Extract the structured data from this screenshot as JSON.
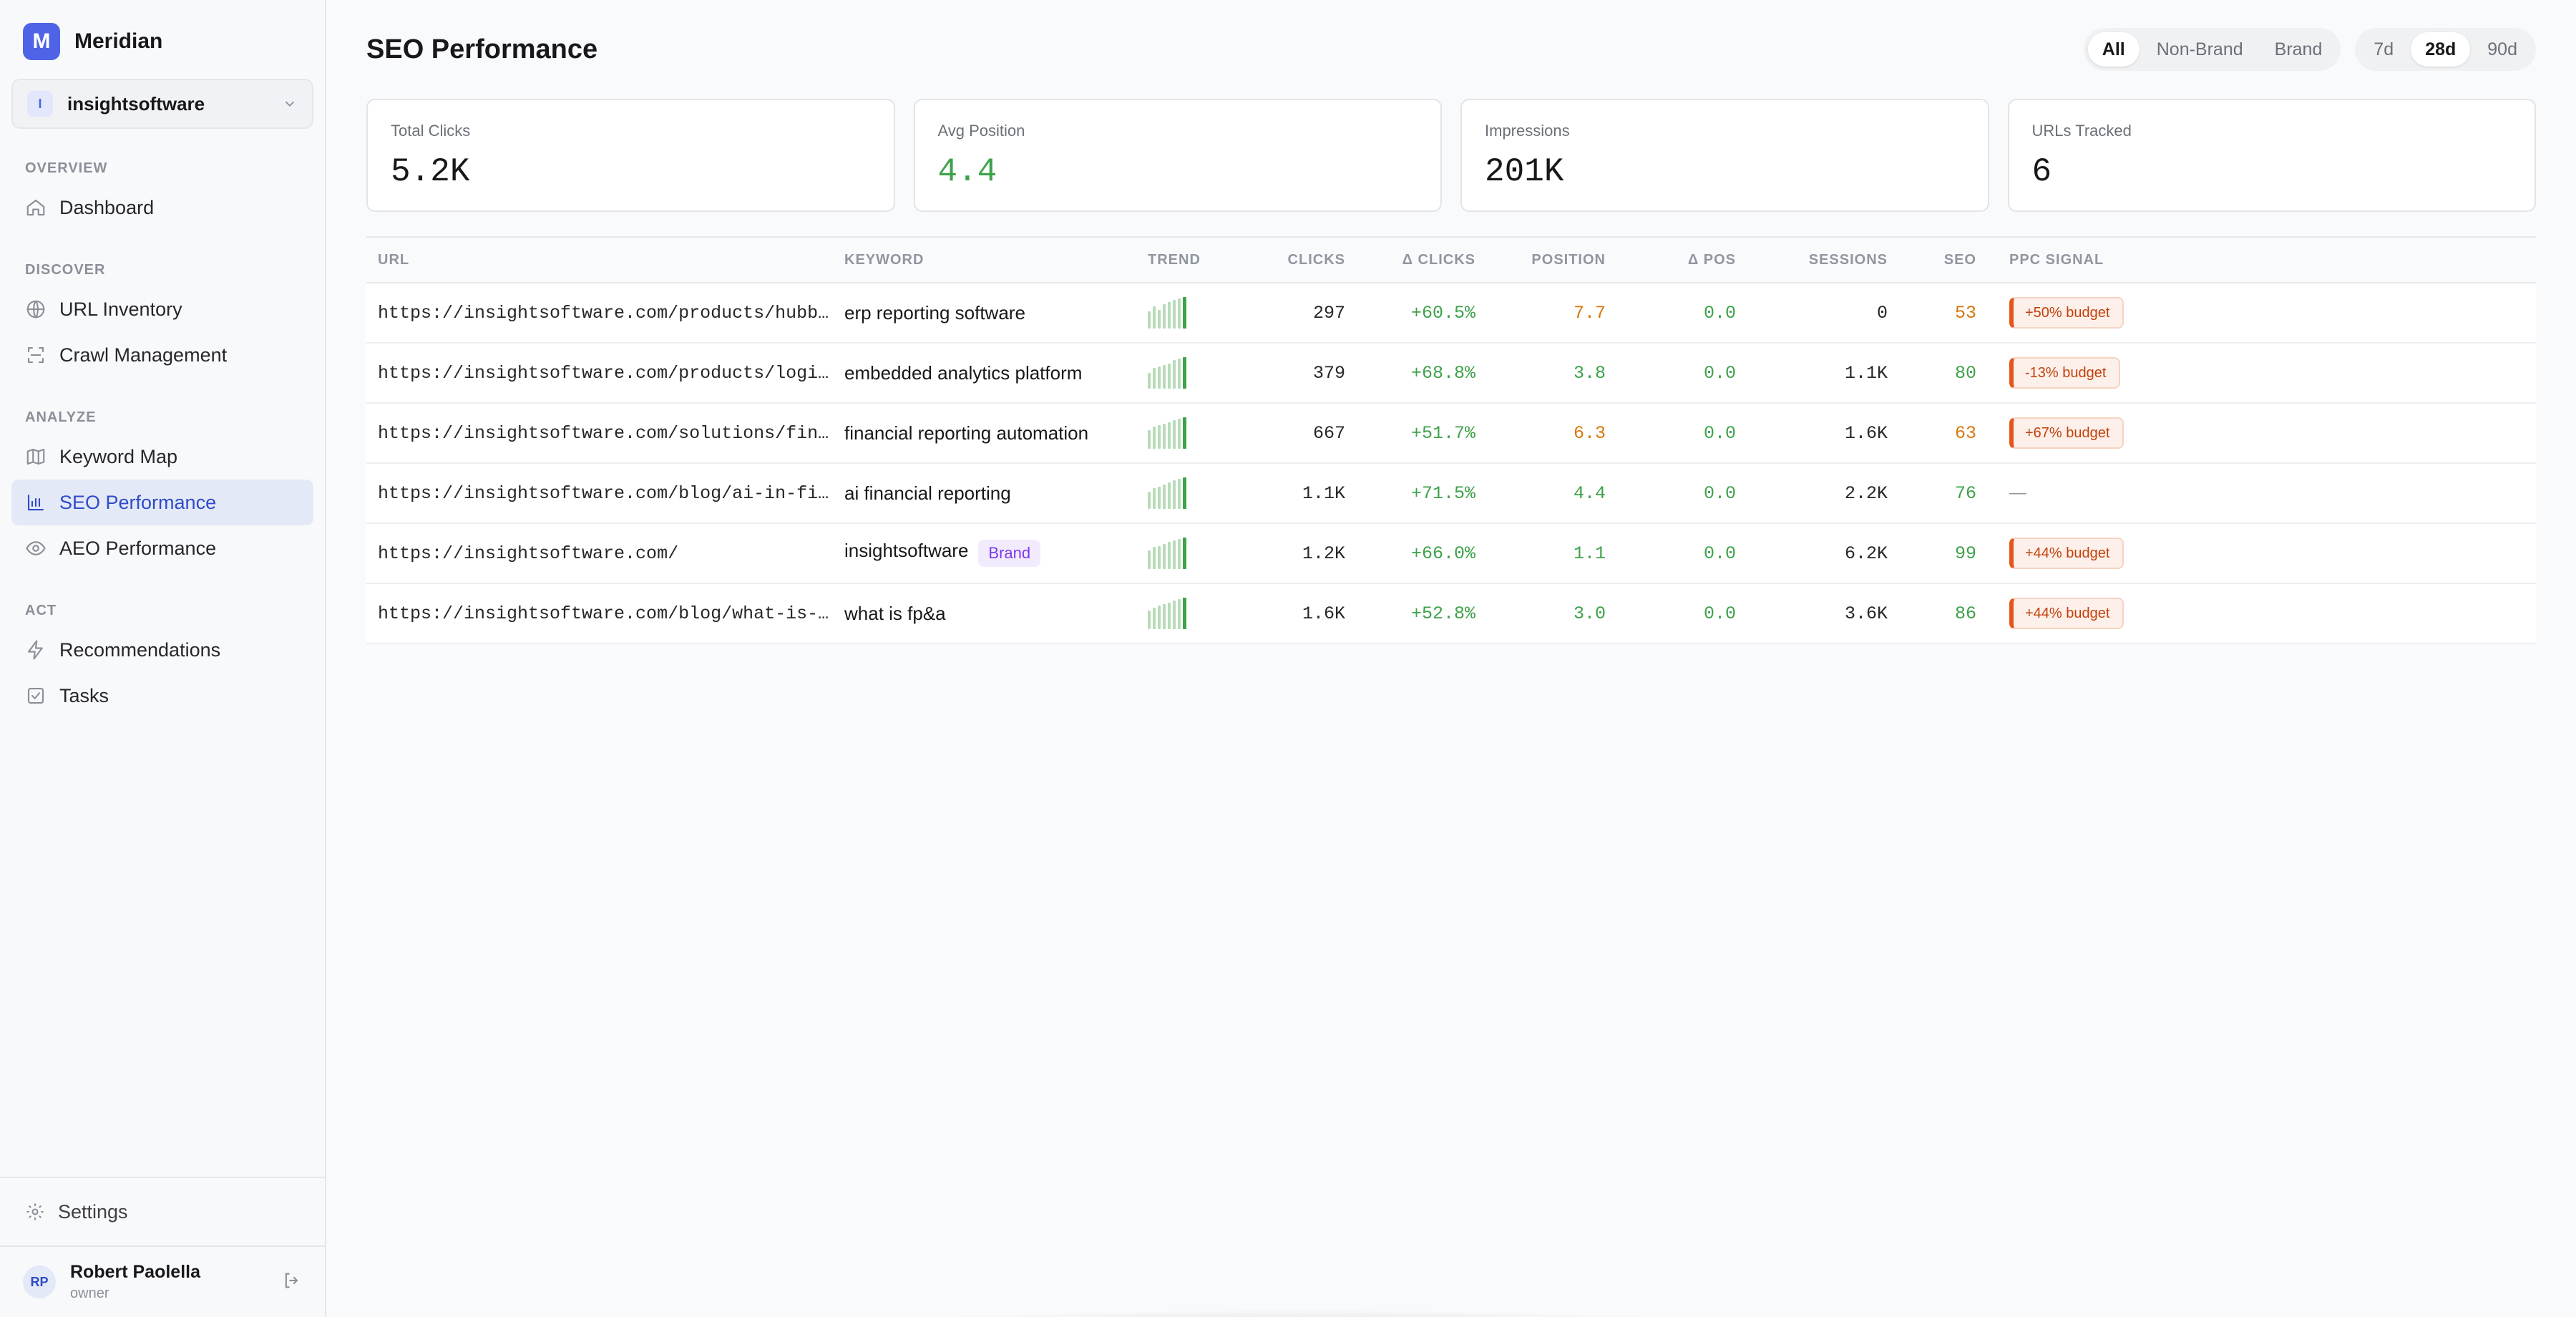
{
  "app": {
    "logo_letter": "M",
    "name": "Meridian"
  },
  "workspace": {
    "badge": "I",
    "name": "insightsoftware"
  },
  "nav": [
    {
      "heading": "OVERVIEW",
      "items": [
        {
          "label": "Dashboard",
          "icon": "home-icon"
        }
      ]
    },
    {
      "heading": "DISCOVER",
      "items": [
        {
          "label": "URL Inventory",
          "icon": "globe-icon"
        },
        {
          "label": "Crawl Management",
          "icon": "scan-icon"
        }
      ]
    },
    {
      "heading": "ANALYZE",
      "items": [
        {
          "label": "Keyword Map",
          "icon": "map-icon"
        },
        {
          "label": "SEO Performance",
          "icon": "bar-chart-icon",
          "active": true
        },
        {
          "label": "AEO Performance",
          "icon": "eye-icon"
        }
      ]
    },
    {
      "heading": "ACT",
      "items": [
        {
          "label": "Recommendations",
          "icon": "lightning-icon"
        },
        {
          "label": "Tasks",
          "icon": "checkbox-icon"
        }
      ]
    }
  ],
  "settings_label": "Settings",
  "user": {
    "initials": "RP",
    "name": "Robert Paolella",
    "role": "owner"
  },
  "page": {
    "title": "SEO Performance"
  },
  "filters": {
    "brand": [
      "All",
      "Non-Brand",
      "Brand"
    ],
    "brand_selected": "All",
    "range": [
      "7d",
      "28d",
      "90d"
    ],
    "range_selected": "28d"
  },
  "kpis": [
    {
      "label": "Total Clicks",
      "value": "5.2K",
      "color": "#18181b"
    },
    {
      "label": "Avg Position",
      "value": "4.4",
      "color": "#3ea24a"
    },
    {
      "label": "Impressions",
      "value": "201K",
      "color": "#18181b"
    },
    {
      "label": "URLs Tracked",
      "value": "6",
      "color": "#18181b"
    }
  ],
  "table": {
    "columns": [
      "URL",
      "KEYWORD",
      "TREND",
      "CLICKS",
      "Δ CLICKS",
      "POSITION",
      "Δ POS",
      "SESSIONS",
      "SEO",
      "PPC SIGNAL"
    ],
    "rows": [
      {
        "url": "https://insightsoftware.com/products/hubble/",
        "keyword": "erp reporting software",
        "brand": "",
        "clicks": "297",
        "d_clicks": "+60.5%",
        "position": "7.7",
        "pos_status": "orange",
        "d_pos": "0.0",
        "sessions": "0",
        "seo": "53",
        "seo_status": "orange",
        "ppc": "+50% budget",
        "trend": [
          0.55,
          0.7,
          0.6,
          0.78,
          0.85,
          0.9,
          0.95,
          1.0
        ]
      },
      {
        "url": "https://insightsoftware.com/products/logi-symphony/",
        "keyword": "embedded analytics platform",
        "brand": "",
        "clicks": "379",
        "d_clicks": "+68.8%",
        "position": "3.8",
        "pos_status": "green",
        "d_pos": "0.0",
        "sessions": "1.1K",
        "seo": "80",
        "seo_status": "green",
        "ppc": "-13% budget",
        "trend": [
          0.5,
          0.65,
          0.7,
          0.75,
          0.8,
          0.9,
          0.95,
          1.0
        ]
      },
      {
        "url": "https://insightsoftware.com/solutions/financial-reporting/",
        "keyword": "financial reporting automation",
        "brand": "",
        "clicks": "667",
        "d_clicks": "+51.7%",
        "position": "6.3",
        "pos_status": "orange",
        "d_pos": "0.0",
        "sessions": "1.6K",
        "seo": "63",
        "seo_status": "orange",
        "ppc": "+67% budget",
        "trend": [
          0.6,
          0.7,
          0.75,
          0.8,
          0.85,
          0.9,
          0.95,
          1.0
        ]
      },
      {
        "url": "https://insightsoftware.com/blog/ai-in-financial-reporting/",
        "keyword": "ai financial reporting",
        "brand": "",
        "clicks": "1.1K",
        "d_clicks": "+71.5%",
        "position": "4.4",
        "pos_status": "green",
        "d_pos": "0.0",
        "sessions": "2.2K",
        "seo": "76",
        "seo_status": "green",
        "ppc": "",
        "trend": [
          0.55,
          0.65,
          0.7,
          0.78,
          0.84,
          0.9,
          0.96,
          1.0
        ]
      },
      {
        "url": "https://insightsoftware.com/",
        "keyword": "insightsoftware",
        "brand": "Brand",
        "clicks": "1.2K",
        "d_clicks": "+66.0%",
        "position": "1.1",
        "pos_status": "green",
        "d_pos": "0.0",
        "sessions": "6.2K",
        "seo": "99",
        "seo_status": "green",
        "ppc": "+44% budget",
        "trend": [
          0.6,
          0.7,
          0.72,
          0.8,
          0.86,
          0.92,
          0.96,
          1.0
        ]
      },
      {
        "url": "https://insightsoftware.com/blog/what-is-fp-and-a/",
        "keyword": "what is fp&a",
        "brand": "",
        "clicks": "1.6K",
        "d_clicks": "+52.8%",
        "position": "3.0",
        "pos_status": "green",
        "d_pos": "0.0",
        "sessions": "3.6K",
        "seo": "86",
        "seo_status": "green",
        "ppc": "+44% budget",
        "trend": [
          0.6,
          0.68,
          0.74,
          0.8,
          0.85,
          0.9,
          0.95,
          1.0
        ]
      }
    ],
    "empty_ppc": "—"
  },
  "colors": {
    "accent": "#4f63e6",
    "positive": "#3ea24a",
    "warning": "#d9770c",
    "ppc": "#e4571c"
  }
}
